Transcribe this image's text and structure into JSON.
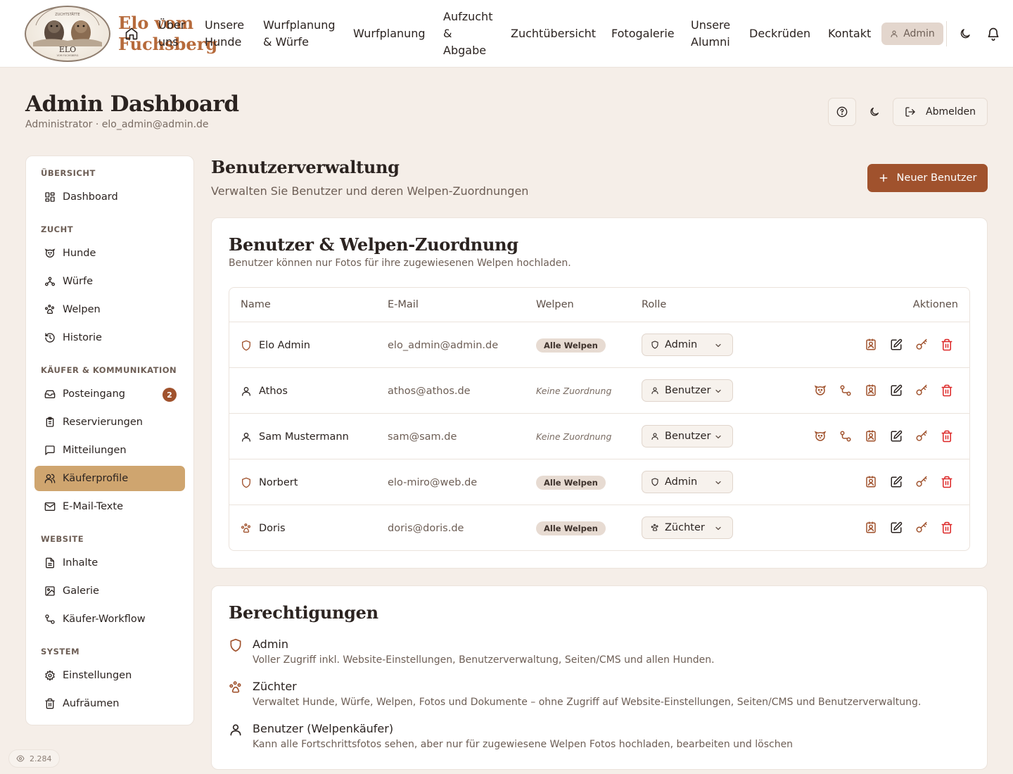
{
  "brand": {
    "name_line1": "Elo vom",
    "name_line2": "Fuchsberg",
    "logo_mark": "ELO",
    "logo_arc": "ZUCHTSTÄTTE",
    "logo_sub": "VOM FUCHSBERG"
  },
  "nav": {
    "items": [
      {
        "line1": "Über",
        "line2": "uns",
        "line3": ""
      },
      {
        "line1": "Unsere",
        "line2": "Hunde",
        "line3": ""
      },
      {
        "line1": "Wurfplanung",
        "line2": "& Würfe",
        "line3": ""
      },
      {
        "line1": "Wurfplanung",
        "line2": "",
        "line3": ""
      },
      {
        "line1": "Aufzucht",
        "line2": "&",
        "line3": "Abgabe"
      },
      {
        "line1": "Zuchtübersicht",
        "line2": "",
        "line3": ""
      },
      {
        "line1": "Fotogalerie",
        "line2": "",
        "line3": ""
      },
      {
        "line1": "Unsere",
        "line2": "Alumni",
        "line3": ""
      },
      {
        "line1": "Deckrüden",
        "line2": "",
        "line3": ""
      },
      {
        "line1": "Kontakt",
        "line2": "",
        "line3": ""
      }
    ],
    "admin_label": "Admin"
  },
  "header": {
    "title": "Admin Dashboard",
    "subtitle": "Administrator · elo_admin@admin.de",
    "logout_label": "Abmelden"
  },
  "sidebar": {
    "sections": {
      "overview": "ÜBERSICHT",
      "breeding": "ZUCHT",
      "buyers": "KÄUFER & KOMMUNIKATION",
      "website": "WEBSITE",
      "system": "SYSTEM"
    },
    "items": {
      "dashboard": "Dashboard",
      "dogs": "Hunde",
      "litters": "Würfe",
      "puppies": "Welpen",
      "history": "Historie",
      "inbox": "Posteingang",
      "inbox_badge": "2",
      "reservations": "Reservierungen",
      "messages": "Mitteilungen",
      "buyer_profiles": "Käuferprofile",
      "email_texts": "E-Mail-Texte",
      "content": "Inhalte",
      "gallery": "Galerie",
      "buyer_workflow": "Käufer-Workflow",
      "settings": "Einstellungen",
      "cleanup": "Aufräumen"
    }
  },
  "main": {
    "title": "Benutzerverwaltung",
    "subtitle": "Verwalten Sie Benutzer und deren Welpen-Zuordnungen",
    "new_user_label": "Neuer Benutzer"
  },
  "users_card": {
    "title": "Benutzer & Welpen-Zuordnung",
    "desc": "Benutzer können nur Fotos für ihre zugewiesenen Welpen hochladen.",
    "columns": {
      "name": "Name",
      "email": "E-Mail",
      "pups": "Welpen",
      "role": "Rolle",
      "actions": "Aktionen"
    },
    "rows": [
      {
        "name": "Elo Admin",
        "email": "elo_admin@admin.de",
        "pups": "Alle Welpen",
        "role": "Admin"
      },
      {
        "name": "Athos",
        "email": "athos@athos.de",
        "pups": "Keine Zuordnung",
        "role": "Benutzer"
      },
      {
        "name": "Sam Mustermann",
        "email": "sam@sam.de",
        "pups": "Keine Zuordnung",
        "role": "Benutzer"
      },
      {
        "name": "Norbert",
        "email": "elo-miro@web.de",
        "pups": "Alle Welpen",
        "role": "Admin"
      },
      {
        "name": "Doris",
        "email": "doris@doris.de",
        "pups": "Alle Welpen",
        "role": "Züchter"
      }
    ]
  },
  "permissions_card": {
    "title": "Berechtigungen",
    "items": [
      {
        "title": "Admin",
        "desc": "Voller Zugriff inkl. Website-Einstellungen, Benutzerverwaltung, Seiten/CMS und allen Hunden."
      },
      {
        "title": "Züchter",
        "desc": "Verwaltet Hunde, Würfe, Welpen, Fotos und Dokumente – ohne Zugriff auf Website-Einstellungen, Seiten/CMS und Benutzerverwaltung."
      },
      {
        "title": "Benutzer (Welpenkäufer)",
        "desc": "Kann alle Fortschrittsfotos sehen, aber nur für zugewiesene Welpen Fotos hochladen, bearbeiten und löschen"
      }
    ]
  },
  "footer": {
    "views": "2.284"
  },
  "colors": {
    "accent": "#a0522d",
    "active_nav": "#cfa56f",
    "background": "#f5eee8",
    "danger": "#dc2626"
  }
}
